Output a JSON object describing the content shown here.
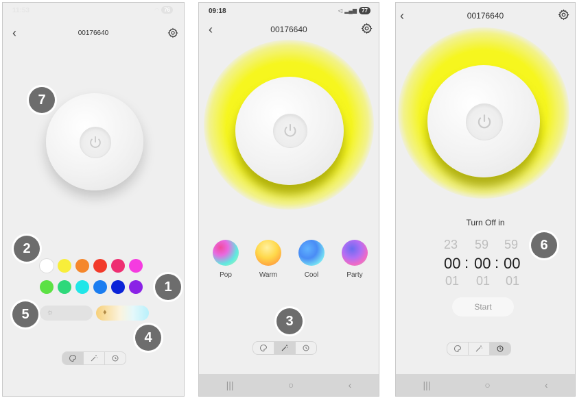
{
  "panels": [
    {
      "status_time": "11:53",
      "battery": "76",
      "title": "00176640",
      "badges": [
        "7",
        "2",
        "1",
        "5",
        "4"
      ],
      "swatches_row1": [
        "#ffffff",
        "#f8ee3a",
        "#f5872b",
        "#f23a2a",
        "#ee2f72",
        "#f53be0"
      ],
      "swatches_row2": [
        "#5ce144",
        "#2ed87a",
        "#20e6e8",
        "#1b7df0",
        "#0b24d8",
        "#8a22e6"
      ]
    },
    {
      "status_time": "09:18",
      "battery": "77",
      "title": "00176640",
      "badges": [
        "3"
      ],
      "scenes": [
        {
          "label": "Pop"
        },
        {
          "label": "Warm"
        },
        {
          "label": "Cool"
        },
        {
          "label": "Party"
        }
      ]
    },
    {
      "title": "00176640",
      "badges": [
        "6"
      ],
      "timer": {
        "label": "Turn Off in",
        "prev": [
          "23",
          "59",
          "59"
        ],
        "current": [
          "00",
          "00",
          "00"
        ],
        "next": [
          "01",
          "01",
          "01"
        ],
        "separator": ":",
        "start_label": "Start"
      }
    }
  ],
  "nav": {
    "recent": "|||",
    "home": "○",
    "back": "‹"
  },
  "back_glyph": "‹",
  "colors": {
    "glow": "#f6f614",
    "badge": "#6d6d6d",
    "panel": "#efefef"
  },
  "icons": [
    "back-icon",
    "gear-icon",
    "power-icon",
    "palette-icon",
    "magic-wand-icon",
    "timer-icon",
    "sun-icon",
    "drop-icon"
  ]
}
